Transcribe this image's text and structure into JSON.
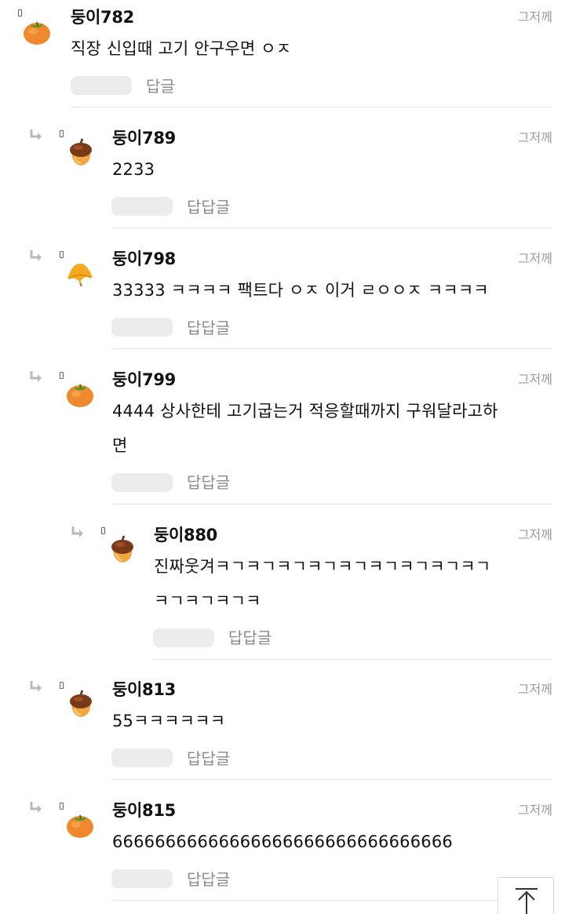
{
  "icons": {
    "reply_arrow": "reply-arrow-icon",
    "marker": "small-square-icon",
    "persimmon": "persimmon-icon",
    "acorn": "acorn-icon",
    "leaf": "autumn-leaf-icon",
    "scroll_top": "arrow-up-to-top-icon"
  },
  "colors": {
    "time": "#9a9a9a",
    "reply_link": "#8a8a8a",
    "divider": "#e4e4e4",
    "like_pill": "#ececec"
  },
  "comments": [
    {
      "nick": "둥이782",
      "time": "그저께",
      "text": "직장 신입때 고기 안구우면 ㅇㅈ",
      "reply_label": "답글",
      "avatar": "persimmon"
    },
    {
      "nick": "둥이789",
      "time": "그저께",
      "text": "2233",
      "reply_label": "답답글",
      "avatar": "acorn"
    },
    {
      "nick": "둥이798",
      "time": "그저께",
      "text": "33333 ㅋㅋㅋㅋ 팩트다 ㅇㅈ 이거 ㄹㅇㅇㅈ ㅋㅋㅋㅋ",
      "reply_label": "답답글",
      "avatar": "leaf"
    },
    {
      "nick": "둥이799",
      "time": "그저께",
      "text_line1": "4444 상사한테 고기굽는거 적응할때까지 구워달라고하",
      "text_line2": "면",
      "reply_label": "답답글",
      "avatar": "persimmon"
    },
    {
      "nick": "둥이880",
      "time": "그저께",
      "text_line1": "진짜웃겨ㅋㄱㅋㄱㅋㄱㅋㄱㅋㄱㅋㄱㅋㄱㅋㄱㅋㄱ",
      "text_line2": "ㅋㄱㅋㄱㅋㄱㅋ",
      "reply_label": "답답글",
      "avatar": "acorn"
    },
    {
      "nick": "둥이813",
      "time": "그저께",
      "text": "55ㅋㅋㅋㅋㅋㅋ",
      "reply_label": "답답글",
      "avatar": "acorn"
    },
    {
      "nick": "둥이815",
      "time": "그저께",
      "text": "66666666666666666666666666666666",
      "reply_label": "답답글",
      "avatar": "persimmon"
    }
  ]
}
